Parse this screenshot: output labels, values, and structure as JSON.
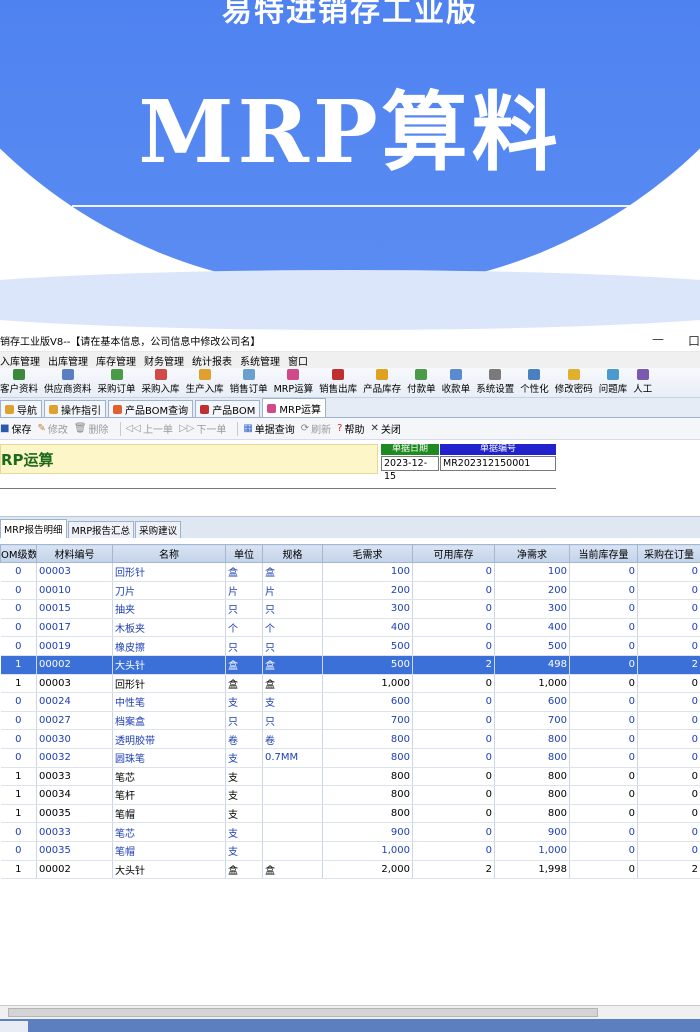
{
  "banner": {
    "top_text": "易特进销存工业版",
    "title": "MRP算料"
  },
  "window": {
    "title": "销存工业版V8--【请在基本信息，公司信息中修改公司名】",
    "controls": [
      "—",
      "口"
    ]
  },
  "menu": [
    "入库管理",
    "出库管理",
    "库存管理",
    "财务管理",
    "统计报表",
    "系统管理",
    "窗口"
  ],
  "toolbar": [
    {
      "label": "客户资料",
      "color": "#3b8a3b"
    },
    {
      "label": "供应商资料",
      "color": "#5a7fc0"
    },
    {
      "label": "采购订单",
      "color": "#4a9a4a"
    },
    {
      "label": "采购入库",
      "color": "#d04a4a"
    },
    {
      "label": "生产入库",
      "color": "#e0a030"
    },
    {
      "label": "销售订单",
      "color": "#6aa0d0"
    },
    {
      "label": "MRP运算",
      "color": "#d04a8a"
    },
    {
      "label": "销售出库",
      "color": "#c03030"
    },
    {
      "label": "产品库存",
      "color": "#e0a020"
    },
    {
      "label": "付款单",
      "color": "#4a9a4a"
    },
    {
      "label": "收款单",
      "color": "#5a8ad0"
    },
    {
      "label": "系统设置",
      "color": "#7a7a7a"
    },
    {
      "label": "个性化",
      "color": "#4a80c0"
    },
    {
      "label": "修改密码",
      "color": "#e0b030"
    },
    {
      "label": "问题库",
      "color": "#4a9ad0"
    },
    {
      "label": "人工",
      "color": "#7a5ab0"
    }
  ],
  "tabs": [
    {
      "label": "导航",
      "color": "#e0a030"
    },
    {
      "label": "操作指引",
      "color": "#e0a030"
    },
    {
      "label": "产品BOM查询",
      "color": "#e06030"
    },
    {
      "label": "产品BOM",
      "color": "#c03030"
    },
    {
      "label": "MRP运算",
      "color": "#d04a8a"
    }
  ],
  "actions": [
    {
      "label": "保存",
      "icon": "■",
      "disabled": false,
      "color": "#2a5ab0"
    },
    {
      "label": "修改",
      "icon": "✎",
      "disabled": true,
      "color": "#c08030"
    },
    {
      "label": "删除",
      "icon": "🗑",
      "disabled": true,
      "color": "#888"
    },
    {
      "label": "上一单",
      "icon": "◁◁",
      "disabled": true,
      "color": "#999"
    },
    {
      "label": "下一单",
      "icon": "▷▷",
      "disabled": true,
      "color": "#999"
    },
    {
      "label": "单据查询",
      "icon": "▦",
      "disabled": false,
      "color": "#3a6ad0"
    },
    {
      "label": "刷新",
      "icon": "⟳",
      "disabled": true,
      "color": "#888"
    },
    {
      "label": "帮助",
      "icon": "?",
      "disabled": false,
      "color": "#d03030"
    },
    {
      "label": "关闭",
      "icon": "✕",
      "disabled": false,
      "color": "#333"
    }
  ],
  "form": {
    "heading": "RP运算",
    "date_label": "单据日期",
    "date_value": "2023-12-15",
    "no_label": "单据编号",
    "no_value": "MR202312150001"
  },
  "subtabs": [
    "MRP报告明细",
    "MRP报告汇总",
    "采购建议"
  ],
  "table": {
    "columns": [
      "OM级数",
      "材料编号",
      "名称",
      "单位",
      "规格",
      "毛需求",
      "可用库存",
      "净需求",
      "当前库存量",
      "采购在订量"
    ],
    "rows": [
      {
        "level": "0",
        "code": "00003",
        "name": "回形针",
        "unit": "盒",
        "spec": "盒",
        "gross": "100",
        "avail": "0",
        "net": "100",
        "stock": "0",
        "onorder": "0",
        "style": "blue"
      },
      {
        "level": "0",
        "code": "00010",
        "name": "刀片",
        "unit": "片",
        "spec": "片",
        "gross": "200",
        "avail": "0",
        "net": "200",
        "stock": "0",
        "onorder": "0",
        "style": "blue"
      },
      {
        "level": "0",
        "code": "00015",
        "name": "抽夹",
        "unit": "只",
        "spec": "只",
        "gross": "300",
        "avail": "0",
        "net": "300",
        "stock": "0",
        "onorder": "0",
        "style": "blue"
      },
      {
        "level": "0",
        "code": "00017",
        "name": "木板夹",
        "unit": "个",
        "spec": "个",
        "gross": "400",
        "avail": "0",
        "net": "400",
        "stock": "0",
        "onorder": "0",
        "style": "blue"
      },
      {
        "level": "0",
        "code": "00019",
        "name": "橡皮擦",
        "unit": "只",
        "spec": "只",
        "gross": "500",
        "avail": "0",
        "net": "500",
        "stock": "0",
        "onorder": "0",
        "style": "blue"
      },
      {
        "level": "1",
        "code": "00002",
        "name": "大头针",
        "unit": "盒",
        "spec": "盒",
        "gross": "500",
        "avail": "2",
        "net": "498",
        "stock": "0",
        "onorder": "2",
        "style": "sel"
      },
      {
        "level": "1",
        "code": "00003",
        "name": "回形针",
        "unit": "盒",
        "spec": "盒",
        "gross": "1,000",
        "avail": "0",
        "net": "1,000",
        "stock": "0",
        "onorder": "0",
        "style": "black"
      },
      {
        "level": "0",
        "code": "00024",
        "name": "中性笔",
        "unit": "支",
        "spec": "支",
        "gross": "600",
        "avail": "0",
        "net": "600",
        "stock": "0",
        "onorder": "0",
        "style": "blue"
      },
      {
        "level": "0",
        "code": "00027",
        "name": "档案盒",
        "unit": "只",
        "spec": "只",
        "gross": "700",
        "avail": "0",
        "net": "700",
        "stock": "0",
        "onorder": "0",
        "style": "blue"
      },
      {
        "level": "0",
        "code": "00030",
        "name": "透明胶带",
        "unit": "卷",
        "spec": "卷",
        "gross": "800",
        "avail": "0",
        "net": "800",
        "stock": "0",
        "onorder": "0",
        "style": "blue"
      },
      {
        "level": "0",
        "code": "00032",
        "name": "圆珠笔",
        "unit": "支",
        "spec": "0.7MM",
        "gross": "800",
        "avail": "0",
        "net": "800",
        "stock": "0",
        "onorder": "0",
        "style": "blue"
      },
      {
        "level": "1",
        "code": "00033",
        "name": "笔芯",
        "unit": "支",
        "spec": "",
        "gross": "800",
        "avail": "0",
        "net": "800",
        "stock": "0",
        "onorder": "0",
        "style": "black"
      },
      {
        "level": "1",
        "code": "00034",
        "name": "笔杆",
        "unit": "支",
        "spec": "",
        "gross": "800",
        "avail": "0",
        "net": "800",
        "stock": "0",
        "onorder": "0",
        "style": "black"
      },
      {
        "level": "1",
        "code": "00035",
        "name": "笔帽",
        "unit": "支",
        "spec": "",
        "gross": "800",
        "avail": "0",
        "net": "800",
        "stock": "0",
        "onorder": "0",
        "style": "black"
      },
      {
        "level": "0",
        "code": "00033",
        "name": "笔芯",
        "unit": "支",
        "spec": "",
        "gross": "900",
        "avail": "0",
        "net": "900",
        "stock": "0",
        "onorder": "0",
        "style": "blue"
      },
      {
        "level": "0",
        "code": "00035",
        "name": "笔帽",
        "unit": "支",
        "spec": "",
        "gross": "1,000",
        "avail": "0",
        "net": "1,000",
        "stock": "0",
        "onorder": "0",
        "style": "blue"
      },
      {
        "level": "1",
        "code": "00002",
        "name": "大头针",
        "unit": "盒",
        "spec": "盒",
        "gross": "2,000",
        "avail": "2",
        "net": "1,998",
        "stock": "0",
        "onorder": "2",
        "style": "black"
      }
    ]
  },
  "colors": {
    "banner_blue": "#4a7ff0",
    "selected_row": "#3a70d8",
    "blue_text": "#1d3fb6",
    "date_label_bg": "#1f8a1f",
    "no_label_bg": "#2222cc"
  }
}
